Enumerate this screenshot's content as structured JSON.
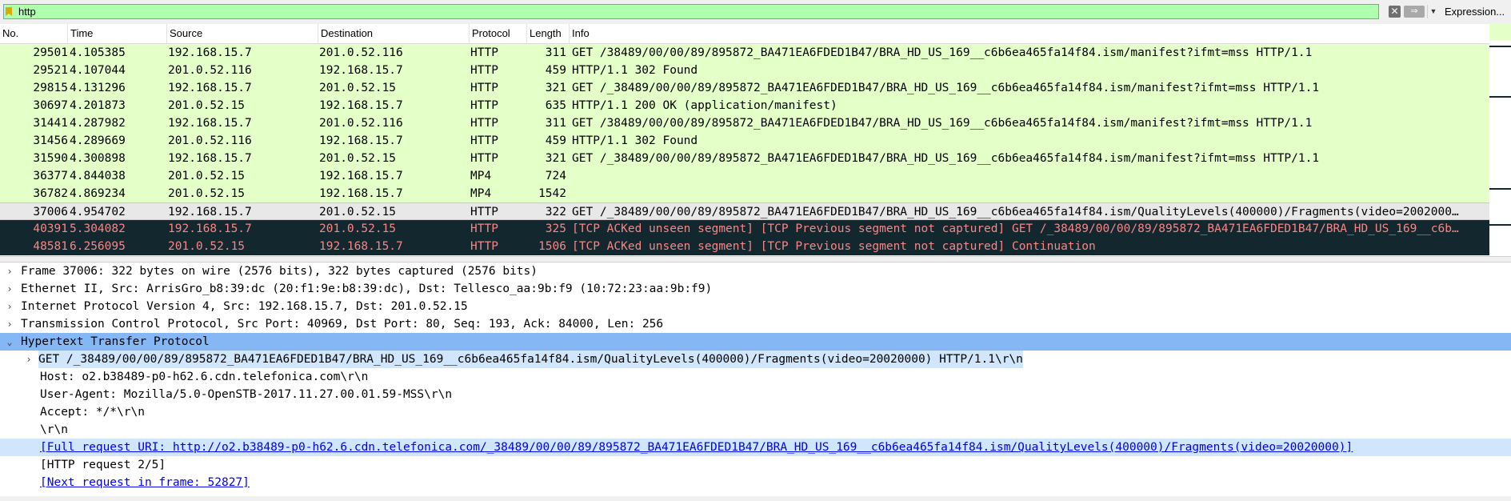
{
  "filter": {
    "value": "http",
    "clear_icon": "clear-icon",
    "apply_icon": "apply-arrow-icon",
    "expression_label": "Expression..."
  },
  "columns": {
    "no": "No.",
    "time": "Time",
    "source": "Source",
    "destination": "Destination",
    "protocol": "Protocol",
    "length": "Length",
    "info": "Info"
  },
  "packets": [
    {
      "no": "29501",
      "time": "4.105385",
      "src": "192.168.15.7",
      "dst": "201.0.52.116",
      "proto": "HTTP",
      "len": "311",
      "info": "GET /38489/00/00/89/895872_BA471EA6FDED1B47/BRA_HD_US_169__c6b6ea465fa14f84.ism/manifest?ifmt=mss HTTP/1.1"
    },
    {
      "no": "29521",
      "time": "4.107044",
      "src": "201.0.52.116",
      "dst": "192.168.15.7",
      "proto": "HTTP",
      "len": "459",
      "info": "HTTP/1.1 302 Found"
    },
    {
      "no": "29815",
      "time": "4.131296",
      "src": "192.168.15.7",
      "dst": "201.0.52.15",
      "proto": "HTTP",
      "len": "321",
      "info": "GET /_38489/00/00/89/895872_BA471EA6FDED1B47/BRA_HD_US_169__c6b6ea465fa14f84.ism/manifest?ifmt=mss HTTP/1.1"
    },
    {
      "no": "30697",
      "time": "4.201873",
      "src": "201.0.52.15",
      "dst": "192.168.15.7",
      "proto": "HTTP",
      "len": "635",
      "info": "HTTP/1.1 200 OK  (application/manifest)"
    },
    {
      "no": "31441",
      "time": "4.287982",
      "src": "192.168.15.7",
      "dst": "201.0.52.116",
      "proto": "HTTP",
      "len": "311",
      "info": "GET /38489/00/00/89/895872_BA471EA6FDED1B47/BRA_HD_US_169__c6b6ea465fa14f84.ism/manifest?ifmt=mss HTTP/1.1"
    },
    {
      "no": "31456",
      "time": "4.289669",
      "src": "201.0.52.116",
      "dst": "192.168.15.7",
      "proto": "HTTP",
      "len": "459",
      "info": "HTTP/1.1 302 Found"
    },
    {
      "no": "31590",
      "time": "4.300898",
      "src": "192.168.15.7",
      "dst": "201.0.52.15",
      "proto": "HTTP",
      "len": "321",
      "info": "GET /_38489/00/00/89/895872_BA471EA6FDED1B47/BRA_HD_US_169__c6b6ea465fa14f84.ism/manifest?ifmt=mss HTTP/1.1"
    },
    {
      "no": "36377",
      "time": "4.844038",
      "src": "201.0.52.15",
      "dst": "192.168.15.7",
      "proto": "MP4",
      "len": "724",
      "info": ""
    },
    {
      "no": "36782",
      "time": "4.869234",
      "src": "201.0.52.15",
      "dst": "192.168.15.7",
      "proto": "MP4",
      "len": "1542",
      "info": ""
    },
    {
      "no": "37006",
      "time": "4.954702",
      "src": "192.168.15.7",
      "dst": "201.0.52.15",
      "proto": "HTTP",
      "len": "322",
      "info": "GET /_38489/00/00/89/895872_BA471EA6FDED1B47/BRA_HD_US_169__c6b6ea465fa14f84.ism/QualityLevels(400000)/Fragments(video=2002000…"
    },
    {
      "no": "40391",
      "time": "5.304082",
      "src": "192.168.15.7",
      "dst": "201.0.52.15",
      "proto": "HTTP",
      "len": "325",
      "info": "[TCP ACKed unseen segment] [TCP Previous segment not captured] GET /_38489/00/00/89/895872_BA471EA6FDED1B47/BRA_HD_US_169__c6b…"
    },
    {
      "no": "48581",
      "time": "6.256095",
      "src": "201.0.52.15",
      "dst": "192.168.15.7",
      "proto": "HTTP",
      "len": "1506",
      "info": "[TCP ACKed unseen segment] [TCP Previous segment not captured] Continuation"
    }
  ],
  "details": [
    {
      "text": "Frame 37006: 322 bytes on wire (2576 bits), 322 bytes captured (2576 bits)"
    },
    {
      "text": "Ethernet II, Src: ArrisGro_b8:39:dc (20:f1:9e:b8:39:dc), Dst: Tellesco_aa:9b:f9 (10:72:23:aa:9b:f9)"
    },
    {
      "text": "Internet Protocol Version 4, Src: 192.168.15.7, Dst: 201.0.52.15"
    },
    {
      "text": "Transmission Control Protocol, Src Port: 40969, Dst Port: 80, Seq: 193, Ack: 84000, Len: 256"
    },
    {
      "text": "Hypertext Transfer Protocol"
    },
    {
      "text": "GET /_38489/00/00/89/895872_BA471EA6FDED1B47/BRA_HD_US_169__c6b6ea465fa14f84.ism/QualityLevels(400000)/Fragments(video=20020000) HTTP/1.1\\r\\n"
    },
    {
      "text": "Host: o2.b38489-p0-h62.6.cdn.telefonica.com\\r\\n"
    },
    {
      "text": "User-Agent: Mozilla/5.0-OpenSTB-2017.11.27.00.01.59-MSS\\r\\n"
    },
    {
      "text": "Accept: */*\\r\\n"
    },
    {
      "text": "\\r\\n"
    },
    {
      "text": "[Full request URI: http://o2.b38489-p0-h62.6.cdn.telefonica.com/_38489/00/00/89/895872_BA471EA6FDED1B47/BRA_HD_US_169__c6b6ea465fa14f84.ism/QualityLevels(400000)/Fragments(video=20020000)]"
    },
    {
      "text": "[HTTP request 2/5]"
    },
    {
      "text": "[Next request in frame: 52827]"
    }
  ],
  "colors": {
    "http_row": "#e4ffc7",
    "selected_row": "#e8e8e8",
    "bad_row_bg": "#12272e",
    "bad_row_fg": "#f78787",
    "tree_selected": "#84b7f3",
    "filter_ok": "#afffaf"
  }
}
